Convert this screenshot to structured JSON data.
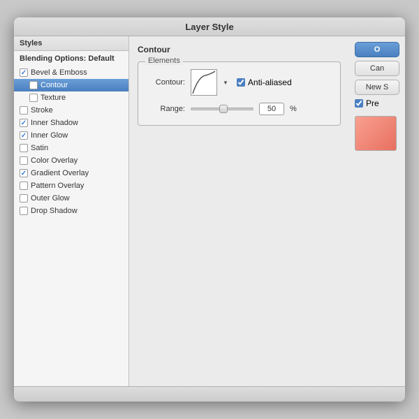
{
  "dialog": {
    "title": "Layer Style"
  },
  "left_panel": {
    "header": "Styles",
    "items": [
      {
        "id": "blending",
        "label": "Blending Options: Default",
        "type": "header",
        "checked": false,
        "active": false
      },
      {
        "id": "bevel",
        "label": "Bevel & Emboss",
        "type": "parent",
        "checked": true,
        "active": false
      },
      {
        "id": "contour",
        "label": "Contour",
        "type": "sub",
        "checked": true,
        "active": true
      },
      {
        "id": "texture",
        "label": "Texture",
        "type": "sub",
        "checked": false,
        "active": false
      },
      {
        "id": "stroke",
        "label": "Stroke",
        "type": "item",
        "checked": false,
        "active": false
      },
      {
        "id": "inner-shadow",
        "label": "Inner Shadow",
        "type": "item",
        "checked": true,
        "active": false
      },
      {
        "id": "inner-glow",
        "label": "Inner Glow",
        "type": "item",
        "checked": true,
        "active": false
      },
      {
        "id": "satin",
        "label": "Satin",
        "type": "item",
        "checked": false,
        "active": false
      },
      {
        "id": "color-overlay",
        "label": "Color Overlay",
        "type": "item",
        "checked": false,
        "active": false
      },
      {
        "id": "gradient-overlay",
        "label": "Gradient Overlay",
        "type": "item",
        "checked": true,
        "active": false
      },
      {
        "id": "pattern-overlay",
        "label": "Pattern Overlay",
        "type": "item",
        "checked": false,
        "active": false
      },
      {
        "id": "outer-glow",
        "label": "Outer Glow",
        "type": "item",
        "checked": false,
        "active": false
      },
      {
        "id": "drop-shadow",
        "label": "Drop Shadow",
        "type": "item",
        "checked": false,
        "active": false
      }
    ]
  },
  "main": {
    "section_title": "Contour",
    "group_title": "Elements",
    "contour_label": "Contour:",
    "anti_alias_label": "Anti-aliased",
    "range_label": "Range:",
    "range_value": "50",
    "range_percent": "%"
  },
  "side_buttons": {
    "ok": "O",
    "cancel": "Can",
    "new_style": "New S",
    "preview_label": "Pre"
  }
}
